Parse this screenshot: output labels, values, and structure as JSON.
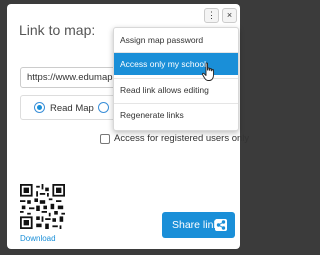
{
  "dialog": {
    "title": "Link to map:",
    "right_link_text": "k",
    "url_value": "https://www.edumaps.",
    "mode_options": [
      {
        "label": "Read Map",
        "selected": true
      },
      {
        "label": "E",
        "selected": false
      }
    ],
    "checkbox_label": "Access for registered users only",
    "download_label": "Download",
    "share_button_label": "Share link",
    "more_glyph": "⋮",
    "close_glyph": "×"
  },
  "menu": {
    "items": [
      {
        "label": "Assign map password",
        "active": false
      },
      {
        "label": "Access only my school",
        "active": true
      },
      {
        "label": "Read link allows editing",
        "active": false
      },
      {
        "label": "Regenerate links",
        "active": false
      }
    ]
  },
  "colors": {
    "accent": "#1a8fd8",
    "overlay": "#3b3b3b"
  }
}
